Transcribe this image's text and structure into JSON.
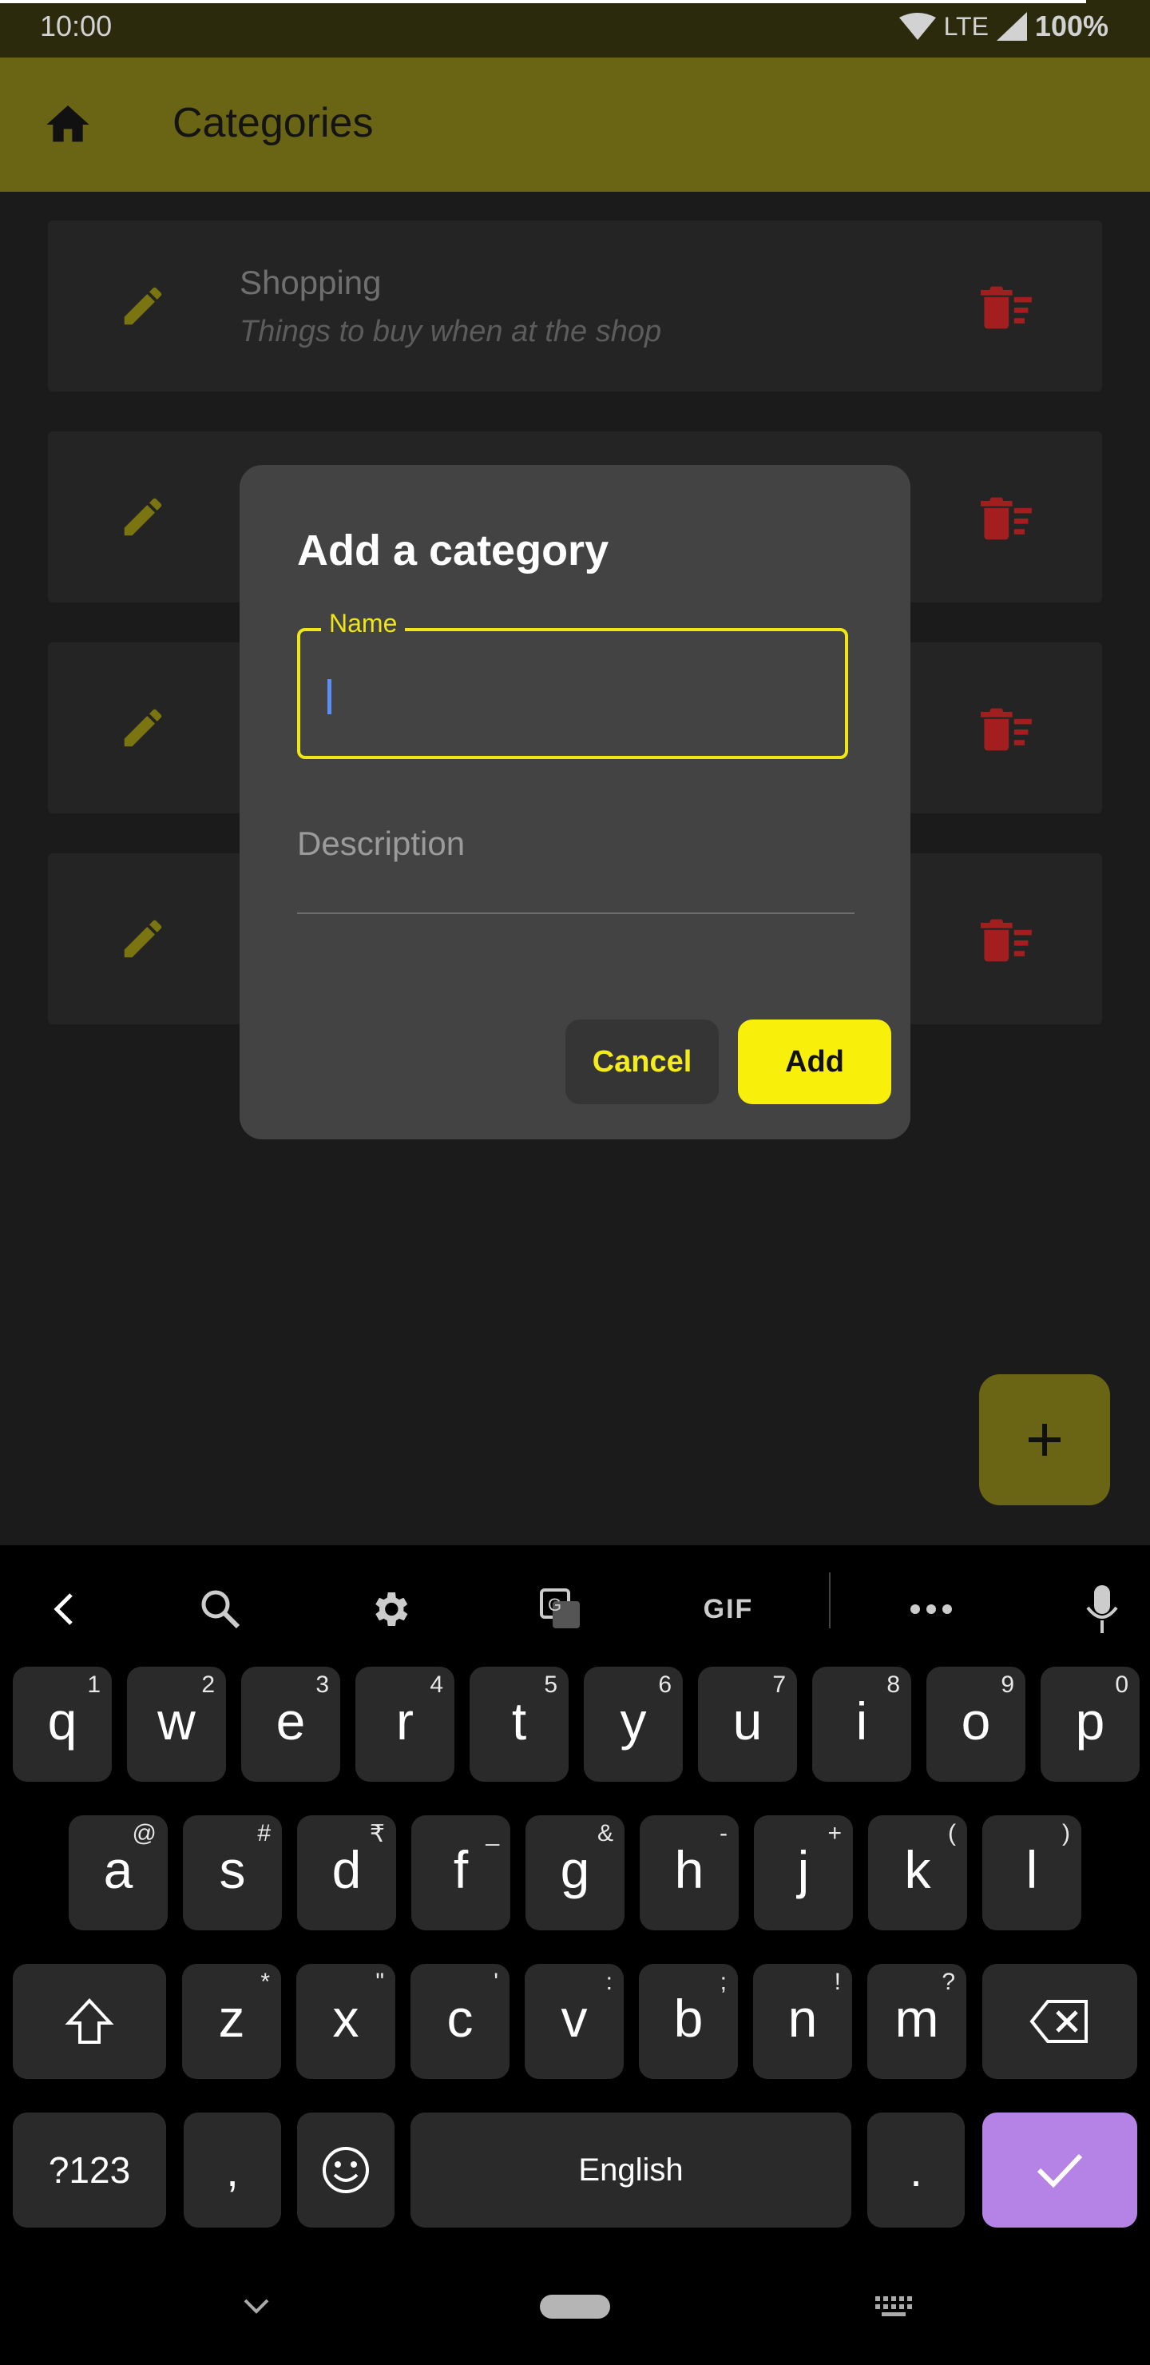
{
  "status_bar": {
    "time": "10:00",
    "network": "LTE",
    "battery": "100%"
  },
  "app_bar": {
    "title": "Categories",
    "home_icon": "home-icon"
  },
  "categories": [
    {
      "name": "Shopping",
      "description": "Things to buy when at the shop"
    }
  ],
  "dialog": {
    "title": "Add a category",
    "name_label": "Name",
    "name_value": "",
    "description_placeholder": "Description",
    "cancel_label": "Cancel",
    "add_label": "Add"
  },
  "fab": {
    "icon": "plus-icon"
  },
  "keyboard": {
    "toolbar_gif": "GIF",
    "row1": [
      {
        "k": "q",
        "s": "1"
      },
      {
        "k": "w",
        "s": "2"
      },
      {
        "k": "e",
        "s": "3"
      },
      {
        "k": "r",
        "s": "4"
      },
      {
        "k": "t",
        "s": "5"
      },
      {
        "k": "y",
        "s": "6"
      },
      {
        "k": "u",
        "s": "7"
      },
      {
        "k": "i",
        "s": "8"
      },
      {
        "k": "o",
        "s": "9"
      },
      {
        "k": "p",
        "s": "0"
      }
    ],
    "row2": [
      {
        "k": "a",
        "s": "@"
      },
      {
        "k": "s",
        "s": "#"
      },
      {
        "k": "d",
        "s": "₹"
      },
      {
        "k": "f",
        "s": "_"
      },
      {
        "k": "g",
        "s": "&"
      },
      {
        "k": "h",
        "s": "-"
      },
      {
        "k": "j",
        "s": "+"
      },
      {
        "k": "k",
        "s": "("
      },
      {
        "k": "l",
        "s": ")"
      }
    ],
    "row3": [
      {
        "k": "z",
        "s": "*"
      },
      {
        "k": "x",
        "s": "\""
      },
      {
        "k": "c",
        "s": "'"
      },
      {
        "k": "v",
        "s": ":"
      },
      {
        "k": "b",
        "s": ";"
      },
      {
        "k": "n",
        "s": "!"
      },
      {
        "k": "m",
        "s": "?"
      }
    ],
    "symbols_key": "?123",
    "comma_key": ",",
    "space_key": "English",
    "period_key": ".",
    "colors": {
      "accent": "#b582e5"
    }
  },
  "colors": {
    "app_bar": "#6a6514",
    "accent_yellow": "#f8f00a",
    "delete_red": "#a31f1f"
  }
}
